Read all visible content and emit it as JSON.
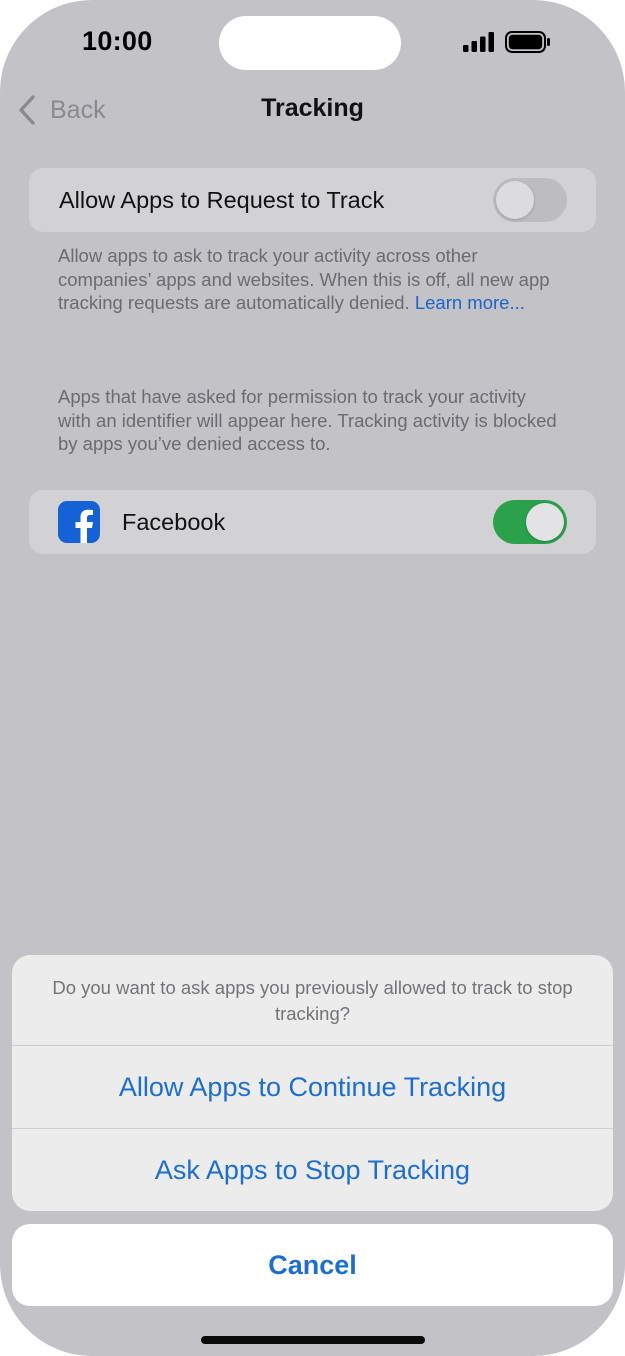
{
  "status_bar": {
    "time": "10:00"
  },
  "nav": {
    "back_label": "Back",
    "title": "Tracking"
  },
  "allow_apps": {
    "label": "Allow Apps to Request to Track",
    "toggle_on": false,
    "description": "Allow apps to ask to track your activity across other companies’ apps and websites. When this is off, all new app tracking requests are automatically denied. ",
    "link": "Learn more..."
  },
  "apps_info": "Apps that have asked for permission to track your activity with an identifier will appear here. Tracking activity is blocked by apps you’ve denied access to.",
  "apps": [
    {
      "name": "Facebook",
      "icon": "facebook-icon",
      "toggle_on": true
    }
  ],
  "action_sheet": {
    "message": "Do you want to ask apps you previously allowed to track to stop tracking?",
    "continue_label": "Allow Apps to Continue Tracking",
    "stop_label": "Ask Apps to Stop Tracking",
    "cancel_label": "Cancel"
  },
  "colors": {
    "accent": "#1c6fd0",
    "toggle_on": "#2aa14a",
    "facebook_blue": "#1462d6"
  }
}
